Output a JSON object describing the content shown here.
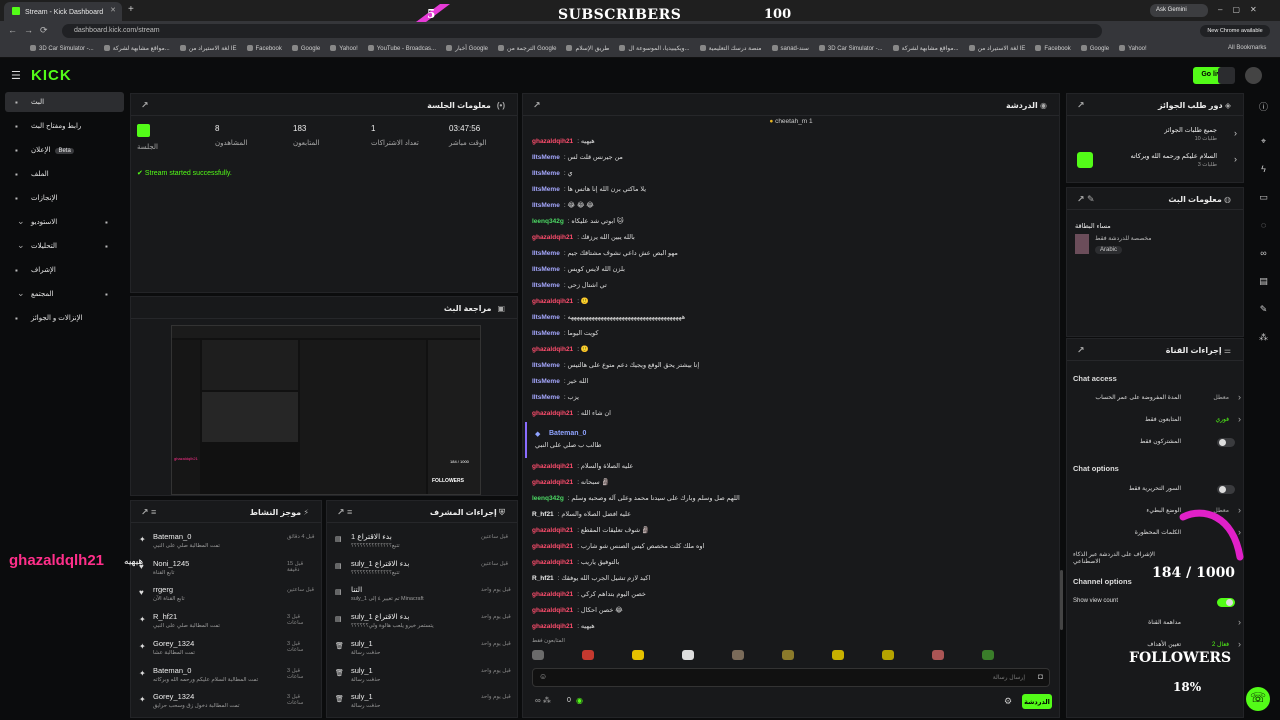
{
  "browser": {
    "tab_title": "Stream - Kick Dashboard",
    "url": "dashboard.kick.com/stream",
    "ask_label": "Ask Gemini",
    "new_chrome": "New Chrome available",
    "all_bookmarks": "All Bookmarks",
    "bookmarks": [
      "3D Car Simulator -...",
      "مواقع مشابهة لشركة...",
      "لغة الاستيراد من IE",
      "Facebook",
      "Google",
      "Yahoo!",
      "YouTube - Broadcas...",
      "أخبار Google",
      "الترجمة من Google",
      "طريق الإسلام",
      "ويكيبيديا، الموسوعة ال...",
      "منصة درسك التعليمية",
      "sanad-سند",
      "3D Car Simulator -...",
      "مواقع مشابهة لشركة...",
      "لغة الاستيراد من IE",
      "Facebook",
      "Google",
      "Yahoo!"
    ]
  },
  "kick": {
    "logo": "KICK",
    "go_live": "Go live"
  },
  "nav": [
    {
      "label": "البث",
      "icon": "broadcast-icon"
    },
    {
      "label": "رابط ومفتاح البث",
      "icon": "key-icon"
    },
    {
      "label": "الإعلان",
      "badge": "Beta",
      "icon": "ad-icon"
    },
    {
      "label": "الملف",
      "icon": "file-icon"
    },
    {
      "label": "الإنجازات",
      "icon": "trophy-icon"
    },
    {
      "label": "الاستوديو",
      "icon": "studio-icon"
    },
    {
      "label": "التحليلات",
      "icon": "chart-icon"
    },
    {
      "label": "الإشراف",
      "icon": "moderation-icon"
    },
    {
      "label": "المجتمع",
      "icon": "community-icon"
    },
    {
      "label": "الإنزالات و الجوائز",
      "icon": "gift-icon"
    }
  ],
  "session": {
    "title": "معلومات الجلسة",
    "stats": [
      {
        "value": "03:47:56",
        "label": "الوقت مباشر"
      },
      {
        "value": "1",
        "label": "تعداد الاشتراكات"
      },
      {
        "value": "183",
        "label": "المتابعون"
      },
      {
        "value": "8",
        "label": "المشاهدون"
      },
      {
        "value": "",
        "label": "الجلسة"
      }
    ],
    "status": "Stream started successfully."
  },
  "preview": {
    "title": "مراجعة البث",
    "mini_followers": "FOLLOWERS",
    "mini_user": "ghazaldqlh21",
    "mini_count": "184 / 1000"
  },
  "chat": {
    "title": "الدردشة",
    "pinned_user": "cheetah_m",
    "pinned_count": "1",
    "lines": [
      {
        "user": "ghazaldqih21",
        "color": "#ff4d6d",
        "msg": "هيهيه"
      },
      {
        "user": "IItsMeme",
        "color": "#a6a8ff",
        "msg": "من جيرنس قلت لس"
      },
      {
        "user": "IItsMeme",
        "color": "#a6a8ff",
        "msg": "ي"
      },
      {
        "user": "IItsMeme",
        "color": "#a6a8ff",
        "msg": "يلا ماكتي برن الله إنا هاتس ها"
      },
      {
        "user": "IItsMeme",
        "color": "#a6a8ff",
        "msg": "😂 😂 😂"
      },
      {
        "user": "leenq342g",
        "color": "#4cd964",
        "msg": "ابوتي شد عليكاه 🐱"
      },
      {
        "user": "ghazaldqih21",
        "color": "#ff4d6d",
        "msg": "بالله يبين الله يرزقك"
      },
      {
        "user": "IItsMeme",
        "color": "#a6a8ff",
        "msg": "مهو البص عش داعي نشوف مشتاقك جيم"
      },
      {
        "user": "IItsMeme",
        "color": "#a6a8ff",
        "msg": "بلزن الله لايس كويس"
      },
      {
        "user": "IItsMeme",
        "color": "#a6a8ff",
        "msg": "تي اشتال زحي"
      },
      {
        "user": "ghazaldqih21",
        "color": "#ff4d6d",
        "msg": "🙂"
      },
      {
        "user": "IItsMeme",
        "color": "#a6a8ff",
        "msg": "ههههههههههههههههههههههههههههههههههههههه"
      },
      {
        "user": "IItsMeme",
        "color": "#a6a8ff",
        "msg": "كويت اليوما"
      },
      {
        "user": "ghazaldqih21",
        "color": "#ff4d6d",
        "msg": "🙂"
      },
      {
        "user": "IItsMeme",
        "color": "#a6a8ff",
        "msg": "إنا بيشتر يحق الوقع ويجيك دعم متوع على هالتيس"
      },
      {
        "user": "IItsMeme",
        "color": "#a6a8ff",
        "msg": "الله خير"
      },
      {
        "user": "IItsMeme",
        "color": "#a6a8ff",
        "msg": "يزب"
      },
      {
        "user": "ghazaldqih21",
        "color": "#ff4d6d",
        "msg": "ان شاء الله"
      }
    ],
    "gift_user": "Bateman_0",
    "gift_msg": "طالب ب صلي على النبي",
    "lines2": [
      {
        "user": "ghazaldqih21",
        "color": "#ff4d6d",
        "msg": "عليه الصلاة والسلام"
      },
      {
        "user": "ghazaldqih21",
        "color": "#ff4d6d",
        "msg": "سبحانه 🗿"
      },
      {
        "user": "leenq342g",
        "color": "#4cd964",
        "msg": "اللهم صل وسلم وبارك على سيدنا محمد وعلى آله وصحبه وسلم"
      },
      {
        "user": "R_hf21",
        "color": "#eeeeee",
        "msg": "عليه افضل الصلاه والسلام"
      },
      {
        "user": "ghazaldqih21",
        "color": "#ff4d6d",
        "msg": "شوف تعليقات المقطع 🗿"
      },
      {
        "user": "ghazaldqih21",
        "color": "#ff4d6d",
        "msg": "اوه ملك كلت مخصص كيس الصنس شو شارب"
      },
      {
        "user": "ghazaldqih21",
        "color": "#ff4d6d",
        "msg": "بالتوفيق ياريب"
      },
      {
        "user": "R_hf21",
        "color": "#eeeeee",
        "msg": "اكيد لازم تشيل الجرب الله يوفقك"
      },
      {
        "user": "ghazaldqih21",
        "color": "#ff4d6d",
        "msg": "خصن اليوم بتداهم كركي"
      },
      {
        "user": "ghazaldqih21",
        "color": "#ff4d6d",
        "msg": "خصن احكال 😂"
      },
      {
        "user": "ghazaldqih21",
        "color": "#ff4d6d",
        "msg": "هيهيه"
      }
    ],
    "followers_only": "المتابعون فقط",
    "input_placeholder": "إرسال رسالة",
    "send": "الدردشة",
    "viewers": "0"
  },
  "activity": {
    "title": "موجز النشاط",
    "items": [
      {
        "name": "Bateman_0",
        "desc": "تمت المطالبة صلي على النبي",
        "time": "قبل 4 دقائق",
        "icon": "reward-icon"
      },
      {
        "name": "Noni_1245",
        "desc": "تابع القناة",
        "time": "قبل 15 دقيقة",
        "icon": "heart-icon"
      },
      {
        "name": "rrgerg",
        "desc": "تابع القناة الآن",
        "time": "قبل ساعتين",
        "icon": "heart-icon"
      },
      {
        "name": "R_hf21",
        "desc": "تمت المطالبة صلي على النبي",
        "time": "قبل 3 ساعات",
        "icon": "reward-icon"
      },
      {
        "name": "Gorey_1324",
        "desc": "تمت المطالبة عشا",
        "time": "قبل 3 ساعات",
        "icon": "reward-icon"
      },
      {
        "name": "Bateman_0",
        "desc": "تمت المطالبة السلام عليكم ورحمه الله وبركاته",
        "time": "قبل 3 ساعات",
        "icon": "reward-icon"
      },
      {
        "name": "Gorey_1324",
        "desc": "تمت المطالبة دخول زق وسحب حرايق",
        "time": "قبل 3 ساعات",
        "icon": "reward-icon"
      }
    ]
  },
  "modactions": {
    "title": "إجراءات المشرف",
    "items": [
      {
        "name": "بدء الاقتراع 1",
        "desc": "تتبع؟؟؟؟؟؟؟؟؟؟؟؟؟؟",
        "time": "قبل ساعتين",
        "icon": "poll-icon"
      },
      {
        "name": "suly_1 بدء الاقتراع",
        "desc": "تتبع؟؟؟؟؟؟؟؟؟؟؟؟؟؟",
        "time": "قبل ساعتين",
        "icon": "poll-icon"
      },
      {
        "name": "التنا",
        "desc": "suly_1 تم تغيير ٤ إلى Minacraft",
        "time": "قبل يوم واحد",
        "icon": "category-icon"
      },
      {
        "name": "suly_1 بدء الاقتراع",
        "desc": "يتستمر خيرو يلعب هالوة ولي؟؟؟؟؟؟",
        "time": "قبل يوم واحد",
        "icon": "poll-icon"
      },
      {
        "name": "suly_1",
        "desc": "حذفت رسالة",
        "time": "قبل يوم واحد",
        "icon": "trash-icon"
      },
      {
        "name": "suly_1",
        "desc": "حذفت رسالة",
        "time": "قبل يوم واحد",
        "icon": "trash-icon"
      },
      {
        "name": "suly_1",
        "desc": "حذفت رسالة",
        "time": "قبل يوم واحد",
        "icon": "trash-icon"
      }
    ]
  },
  "rewards": {
    "title": "دور طلب الجوائز",
    "item1": "جميع طلبات الجوائز",
    "item1_sub": "طلبات 10",
    "item2": "السلام عليكم ورحمه الله وبركاته",
    "item2_sub": "طلبات 3"
  },
  "streaminfo": {
    "title": "معلومات البث",
    "name": "مساء البطاقة",
    "sub": "مخصصة للدردشة فقط",
    "lang": "Arabic"
  },
  "channelactions": {
    "title": "إجراءات القناة",
    "chat_access": "Chat access",
    "rows_access": [
      {
        "label": "المدة المفروضة على عمر الحساب",
        "value": "معطل"
      },
      {
        "label": "المتابعون فقط",
        "value": "فوري"
      },
      {
        "label": "المشتركون فقط",
        "value": ""
      }
    ],
    "chat_options": "Chat options",
    "rows_options": [
      {
        "label": "السور التحريرية فقط",
        "value": ""
      },
      {
        "label": "الوضع البطيء",
        "value": "معطل"
      },
      {
        "label": "الكلمات المحظورة",
        "value": ""
      },
      {
        "label": "الإشراف على الدردشة عبر الذكاء الاصطناعي",
        "value": ""
      }
    ],
    "channel_options": "Channel options",
    "show_view_count": "Show view count",
    "rows_channel": [
      {
        "label": "مداهمة القناة",
        "value": ""
      },
      {
        "label": "تعيين الأهداف",
        "value": "فعال 2"
      }
    ]
  },
  "overlay": {
    "subscribers_label": "SUBSCRIBERS",
    "subscribers_goal": "100",
    "subscribers_count": "5",
    "followers_label": "FOLLOWERS",
    "followers_frac": "184 / 1000",
    "followers_pct": "18%",
    "alert_user": "ghazaldqlh21",
    "alert_emoji": "هيهيه"
  },
  "colors": {
    "accent": "#53fc18",
    "bg": "#0b0c0d",
    "panel": "#18191b",
    "overlay_pink": "#ff2f8a"
  }
}
